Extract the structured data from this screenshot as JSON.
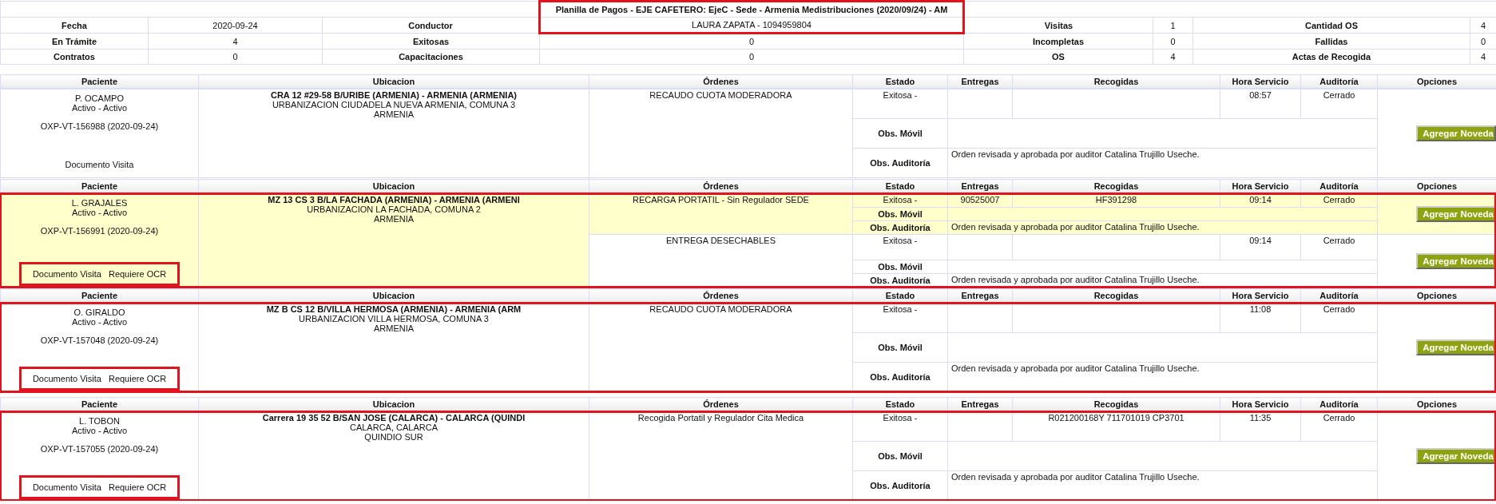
{
  "summary": {
    "title": "Planilla de Pagos - EJE CAFETERO: EjeC - Sede - Armenia Medistribuciones (2020/09/24) - AM",
    "annotated": true,
    "rows": [
      [
        {
          "label": "Fecha",
          "value": "2020-09-24"
        },
        {
          "label": "Conductor",
          "value": "LAURA ZAPATA - 1094959804"
        },
        {
          "label": "Visitas",
          "value": "1"
        },
        {
          "label": "Cantidad OS",
          "value": "4"
        }
      ],
      [
        {
          "label": "En Trámite",
          "value": "4"
        },
        {
          "label": "Exitosas",
          "value": "0"
        },
        {
          "label": "Incompletas",
          "value": "0"
        },
        {
          "label": "Fallidas",
          "value": "0"
        }
      ],
      [
        {
          "label": "Contratos",
          "value": "0"
        },
        {
          "label": "Capacitaciones",
          "value": "0"
        },
        {
          "label": "OS",
          "value": "4"
        },
        {
          "label": "Actas de Recogida",
          "value": "4"
        }
      ]
    ]
  },
  "visits": [
    {
      "columns": [
        "Paciente",
        "Ubicacion",
        "Órdenes",
        "Estado",
        "Entregas",
        "Recogidas",
        "Hora Servicio",
        "Auditoría",
        "Opciones"
      ],
      "annotated": false,
      "highlighted": false,
      "patient": "P. OCAMPO",
      "status": "Activo - Activo",
      "visit_code": "OXP-VT-156988 (2020-09-24)",
      "documents": [
        "Documento Visita"
      ],
      "documents_annotated": false,
      "address": "CRA 12 #29-58 B/URIBE (ARMENIA) - ARMENIA (ARMENIA)",
      "address_lines": [
        "URBANIZACION CIUDADELA NUEVA ARMENIA, COMUNA 3",
        "ARMENIA"
      ],
      "orders": [
        {
          "name": "RECAUDO CUOTA MODERADORA",
          "highlighted": false,
          "estado": "Exitosa -",
          "hora": "08:57",
          "auditoria": "Cerrado",
          "obs_movil_label": "Obs. Móvil",
          "obs_auditoria_label": "Obs. Auditoría",
          "obs_auditoria": "Orden revisada y aprobada por auditor Catalina Trujillo Useche.",
          "button": "Agregar Noveda"
        }
      ]
    },
    {
      "columns": [
        "Paciente",
        "Ubicacion",
        "Órdenes",
        "Estado",
        "Entregas",
        "Recogidas",
        "Hora Servicio",
        "Auditoría",
        "Opciones"
      ],
      "annotated": true,
      "highlighted": true,
      "patient": "L. GRAJALES",
      "status": "Activo - Activo",
      "visit_code": "OXP-VT-156991 (2020-09-24)",
      "documents": [
        "Documento Visita",
        "Requiere OCR"
      ],
      "documents_annotated": true,
      "address": "MZ 13 CS 3 B/LA FACHADA (ARMENIA) - ARMENIA (ARMENI",
      "address_lines": [
        "URBANIZACION LA FACHADA, COMUNA 2",
        "ARMENIA"
      ],
      "orders": [
        {
          "name": "RECARGA PORTATIL - Sin Regulador SEDE",
          "highlighted": true,
          "estado": "Exitosa -",
          "entregas": "90525007",
          "recogidas": "HF391298",
          "hora": "09:14",
          "auditoria": "Cerrado",
          "obs_movil_label": "Obs. Móvil",
          "obs_auditoria_label": "Obs. Auditoría",
          "obs_auditoria": "Orden revisada y aprobada por auditor Catalina Trujillo Useche.",
          "button": "Agregar Noveda"
        },
        {
          "name": "ENTREGA DESECHABLES",
          "highlighted": false,
          "estado": "Exitosa -",
          "hora": "09:14",
          "auditoria": "Cerrado",
          "obs_movil_label": "Obs. Móvil",
          "obs_auditoria_label": "Obs. Auditoría",
          "obs_auditoria": "Orden revisada y aprobada por auditor Catalina Trujillo Useche.",
          "button": "Agregar Noveda"
        }
      ]
    },
    {
      "columns": [
        "Paciente",
        "Ubicacion",
        "Órdenes",
        "Estado",
        "Entregas",
        "Recogidas",
        "Hora Servicio",
        "Auditoría",
        "Opciones"
      ],
      "annotated": true,
      "highlighted": false,
      "patient": "O. GIRALDO",
      "status": "Activo - Activo",
      "visit_code": "OXP-VT-157048 (2020-09-24)",
      "documents": [
        "Documento Visita",
        "Requiere OCR"
      ],
      "documents_annotated": true,
      "address": "MZ B CS 12 B/VILLA HERMOSA (ARMENIA) - ARMENIA (ARM",
      "address_lines": [
        "URBANIZACION VILLA HERMOSA, COMUNA 3",
        "ARMENIA"
      ],
      "orders": [
        {
          "name": "RECAUDO CUOTA MODERADORA",
          "highlighted": false,
          "estado": "Exitosa -",
          "hora": "11:08",
          "auditoria": "Cerrado",
          "obs_movil_label": "Obs. Móvil",
          "obs_auditoria_label": "Obs. Auditoría",
          "obs_auditoria": "Orden revisada y aprobada por auditor Catalina Trujillo Useche.",
          "button": "Agregar Noveda"
        }
      ]
    },
    {
      "columns": [
        "Paciente",
        "Ubicacion",
        "Órdenes",
        "Estado",
        "Entregas",
        "Recogidas",
        "Hora Servicio",
        "Auditoría",
        "Opciones"
      ],
      "annotated": true,
      "highlighted": false,
      "patient": "L. TOBON",
      "status": "Activo - Activo",
      "visit_code": "OXP-VT-157055 (2020-09-24)",
      "documents": [
        "Documento Visita",
        "Requiere OCR"
      ],
      "documents_annotated": true,
      "address": "Carrera 19 35 52 B/SAN JOSE (CALARCA) - CALARCA (QUINDI",
      "address_lines": [
        "CALARCA, CALARCA",
        "QUINDIO SUR"
      ],
      "orders": [
        {
          "name": "Recogida Portatil y Regulador Cita Medica",
          "highlighted": false,
          "estado": "Exitosa -",
          "recogidas": "R021200168Y 711701019 CP3701",
          "hora": "11:35",
          "auditoria": "Cerrado",
          "obs_movil_label": "Obs. Móvil",
          "obs_auditoria_label": "Obs. Auditoría",
          "obs_auditoria": "Orden revisada y aprobada por auditor Catalina Trujillo Useche.",
          "button": "Agregar Noveda"
        }
      ]
    }
  ]
}
